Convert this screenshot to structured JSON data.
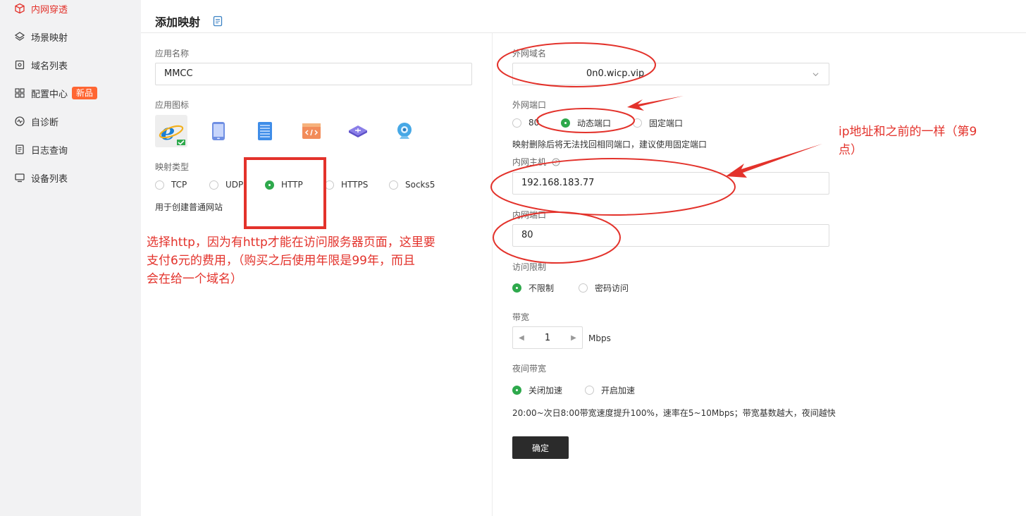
{
  "sidebar": {
    "items": [
      {
        "label": "内网穿透",
        "icon": "cube-icon",
        "active": true
      },
      {
        "label": "场景映射",
        "icon": "layers-icon"
      },
      {
        "label": "域名列表",
        "icon": "domain-list-icon"
      },
      {
        "label": "配置中心",
        "icon": "grid-icon",
        "badge": "新品"
      },
      {
        "label": "自诊断",
        "icon": "diagnose-icon"
      },
      {
        "label": "日志查询",
        "icon": "log-icon"
      },
      {
        "label": "设备列表",
        "icon": "monitor-icon"
      }
    ]
  },
  "header": {
    "title": "添加映射",
    "doc_icon": "document-icon"
  },
  "left": {
    "app_name_label": "应用名称",
    "app_name_value": "MMCC",
    "app_icon_label": "应用图标",
    "app_icons": [
      "ie-browser-icon",
      "phone-icon",
      "server-icon",
      "code-icon",
      "network-icon",
      "camera-icon"
    ],
    "mapping_type_label": "映射类型",
    "mapping_types": [
      "TCP",
      "UDP",
      "HTTP",
      "HTTPS",
      "Socks5"
    ],
    "mapping_type_selected": "HTTP",
    "mapping_type_hint": "用于创建普通网站"
  },
  "right": {
    "domain_label": "外网域名",
    "domain_value": "0n0.wicp.vip",
    "port_label": "外网端口",
    "port_options": [
      "80",
      "动态端口",
      "固定端口"
    ],
    "port_selected": "动态端口",
    "port_hint": "映射删除后将无法找回相同端口，建议使用固定端口",
    "host_label": "内网主机",
    "host_value": "192.168.183.77",
    "inner_port_label": "内网端口",
    "inner_port_value": "80",
    "access_label": "访问限制",
    "access_options": [
      "不限制",
      "密码访问"
    ],
    "access_selected": "不限制",
    "bandwidth_label": "带宽",
    "bandwidth_value": "1",
    "bandwidth_unit": "Mbps",
    "night_label": "夜间带宽",
    "night_options": [
      "关闭加速",
      "开启加速"
    ],
    "night_selected": "关闭加速",
    "night_hint": "20:00~次日8:00带宽速度提升100%，速率在5~10Mbps；带宽基数越大，夜间越快",
    "submit_label": "确定"
  },
  "annotations": {
    "left_note_lines": [
      "选择http，因为有http才能在访问服务器页面，这里要",
      "支付6元的费用，（购买之后使用年限是99年，而且",
      "会在给一个域名）"
    ],
    "right_note_lines": [
      "ip地址和之前的一样（第9",
      "点）"
    ],
    "color": "#e3322b"
  },
  "colors": {
    "accent_green": "#2ea94c",
    "active_red": "#e3322b",
    "badge_orange": "#ff6633"
  }
}
